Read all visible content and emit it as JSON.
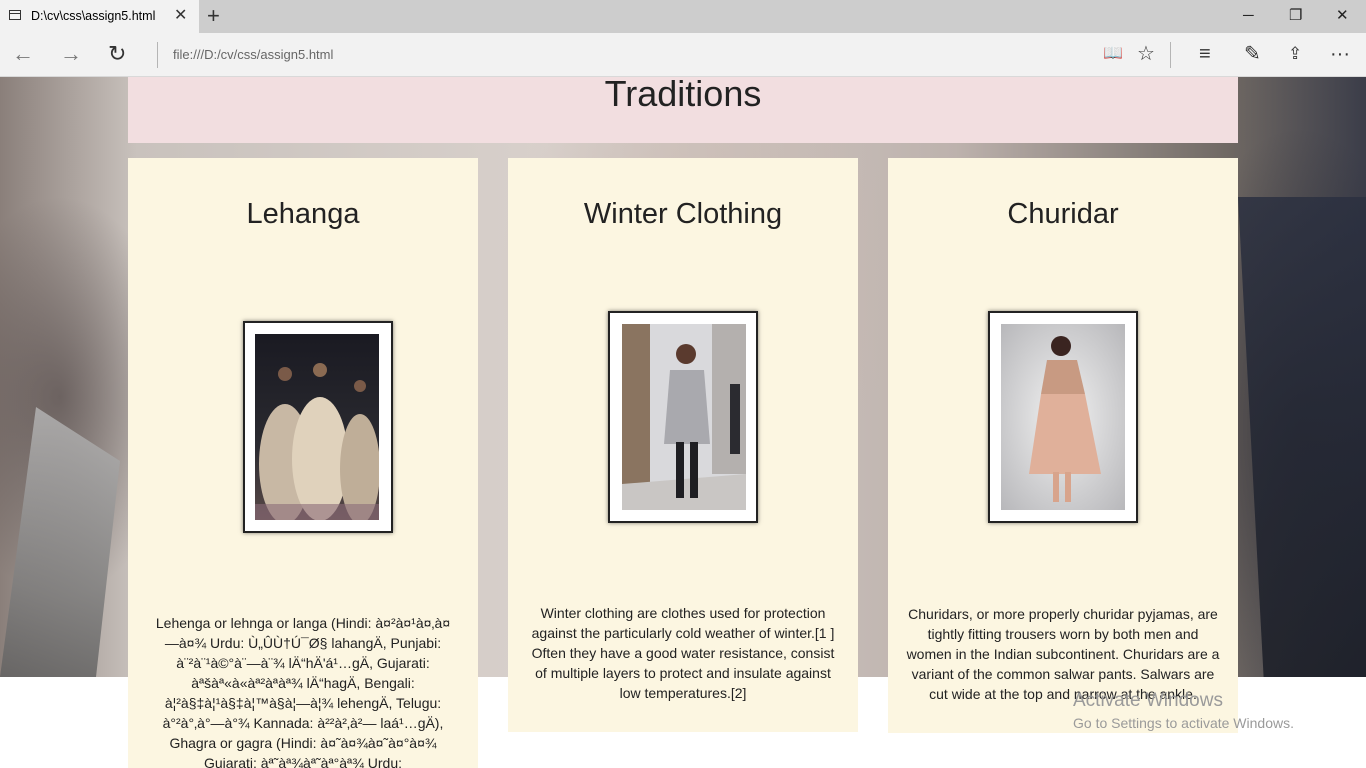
{
  "browser": {
    "tab_title": "D:\\cv\\css\\assign5.html",
    "tab_close": "✕",
    "new_tab": "+",
    "minimize": "─",
    "restore": "❐",
    "close": "✕",
    "back": "←",
    "forward": "→",
    "refresh": "↻",
    "address": "file:///D:/cv/css/assign5.html",
    "reading_view": "📖",
    "favorite": "☆",
    "hub": "≡",
    "web_note": "✎",
    "share": "⇪",
    "more": "···"
  },
  "page": {
    "title": "Traditions",
    "cards": [
      {
        "heading": "Lehanga",
        "text": "Lehenga or lehnga or langa (Hindi: à¤²à¤¹à¤‚à¤—à¤¾ Urdu: Ù„ÛÙ†Ú¯Ø§ lahangÄ, Punjabi: à¨²à¨¹à©°à¨—à¨¾ lÄ“hÄ'á¹…gÄ, Gujarati: àªšàª«à«àª²àªàª¾ lÄ“hagÄ, Bengali: à¦²à§‡à¦¹à§‡à¦™à§à¦—à¦¾ lehengÄ, Telugu: à°²à°‚à°—à°¾ Kannada: à²²à²‚à²— laá¹…gÄ), Ghagra or gagra (Hindi: à¤˜à¤¾à¤˜à¤°à¤¾ Gujarati: àª˜àª¾àª˜àª°àª¾ Urdu:"
      },
      {
        "heading": "Winter Clothing",
        "text": "Winter clothing are clothes used for protection against the particularly cold weather of winter.[1 ] Often they have a good water resistance, consist of multiple layers to protect and insulate against low temperatures.[2]"
      },
      {
        "heading": "Churidar",
        "text": "Churidars, or more properly churidar pyjamas, are tightly fitting trousers worn by both men and women in the Indian subcontinent. Churidars are a variant of the common salwar pants. Salwars are cut wide at the top and narrow at the ankle."
      }
    ]
  },
  "watermark": {
    "line1": "Activate Windows",
    "line2": "Go to Settings to activate Windows."
  }
}
